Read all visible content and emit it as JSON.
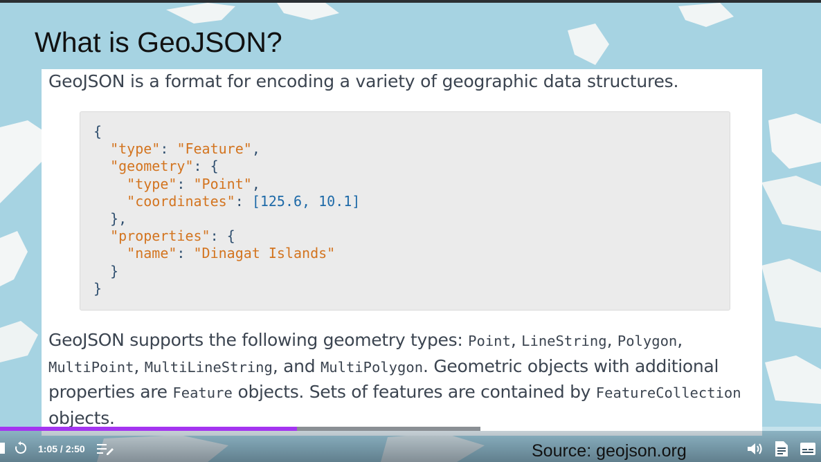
{
  "slide": {
    "title": "What is GeoJSON?",
    "intro": "GeoJSON is a format for encoding a variety of geographic data structures.",
    "code": {
      "l1": "{",
      "type_key": "\"type\"",
      "type_val": "\"Feature\"",
      "geometry_key": "\"geometry\"",
      "gtype_key": "\"type\"",
      "gtype_val": "\"Point\"",
      "coords_key": "\"coordinates\"",
      "coords_val": "[125.6, 10.1]",
      "close_geom": "},",
      "props_key": "\"properties\"",
      "name_key": "\"name\"",
      "name_val": "\"Dinagat Islands\"",
      "close_props": "}",
      "close_root": "}"
    },
    "description": {
      "t1": "GeoJSON supports the following geometry types: ",
      "c_point": "Point",
      "sep1": ", ",
      "c_linestring": "LineString",
      "sep2": ", ",
      "c_polygon": "Polygon",
      "sep3": ",",
      "c_multipoint": "MultiPoint",
      "sep4": ", ",
      "c_multilinestring": "MultiLineString",
      "sep5": ", and ",
      "c_multipolygon": "MultiPolygon",
      "t2": ". Geometric objects with additional properties are ",
      "c_feature": "Feature",
      "t3": " objects. Sets of features are contained by ",
      "c_featurecollection": "FeatureCollection",
      "t4": " objects."
    },
    "source": "Source: geojson.org"
  },
  "player": {
    "time": "1:05 / 2:50",
    "progress_played": 0.362,
    "progress_buffered": 0.585,
    "icons": [
      "rewind-icon",
      "playlist-icon",
      "volume-icon",
      "transcript-icon",
      "captions-icon"
    ]
  },
  "colors": {
    "accent": "#a435f0",
    "map_water": "#a6d3e2",
    "code_key": "#d3741f",
    "code_number": "#1e6aa8"
  }
}
